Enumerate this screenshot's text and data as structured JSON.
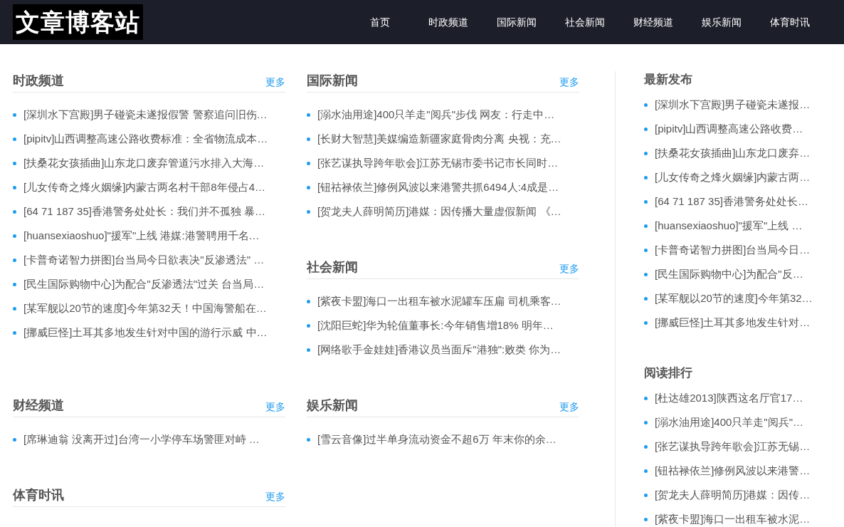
{
  "header": {
    "logo": "文章博客站",
    "nav": [
      "首页",
      "时政频道",
      "国际新闻",
      "社会新闻",
      "财经频道",
      "娱乐新闻",
      "体育时讯"
    ]
  },
  "main_rows": [
    {
      "columns": [
        [
          {
            "title": "时政频道",
            "more": "更多",
            "items": [
              "[深圳水下宫殿]男子碰瓷未遂报假警 警察追问旧伤…",
              "[pipitv]山西调整高速公路收费标准：全省物流成本…",
              "[扶桑花女孩插曲]山东龙口废弃管道污水排入大海…",
              "[儿女传奇之烽火姻缘]内蒙古两名村干部8年侵占4…",
              "[64 71 187 35]香港警务处处长：我们并不孤独 暴…",
              "[huansexiaoshuo]\"援军\"上线 港媒:港警聘用千名…",
              "[卡普奇诺智力拼图]台当局今日欲表决\"反渗透法\" …",
              "[民生国际购物中心]为配合\"反渗透法\"过关 台当局…",
              "[某军舰以20节的速度]今年第32天！中国海警船在…",
              "[挪威巨怪]土耳其多地发生针对中国的游行示威 中…"
            ]
          }
        ],
        [
          {
            "title": "国际新闻",
            "more": "更多",
            "items": [
              "[溺水油用途]400只羊走\"阅兵\"步伐 网友：行走中…",
              "[长财大智慧]美媒编造新疆家庭骨肉分离 央视：充…",
              "[张艺谋执导跨年歌会]江苏无锡市委书记市长同时…",
              "[钮祜禄依兰]修例风波以来港警共抓6494人:4成是…",
              "[贺龙夫人薛明简历]港媒：因传播大量虚假新闻 《…"
            ]
          },
          {
            "title": "社会新闻",
            "more": "更多",
            "items": [
              "[紫夜卡盟]海口一出租车被水泥罐车压扁 司机乘客…",
              "[沈阳巨蛇]华为轮值董事长:今年销售增18% 明年…",
              "[网络歌手金娃娃]香港议员当面斥\"港独\":败类 你为…"
            ]
          }
        ]
      ]
    },
    {
      "columns": [
        [
          {
            "title": "财经频道",
            "more": "更多",
            "items": [
              "[席琳迪翁 没离开过]台湾一小学停车场警匪对峙 …"
            ]
          }
        ],
        [
          {
            "title": "娱乐新闻",
            "more": "更多",
            "items": [
              "[雪云音像]过半单身流动资金不超6万 年末你的余…"
            ]
          }
        ]
      ]
    },
    {
      "columns": [
        [
          {
            "title": "体育时讯",
            "more": "更多"
          }
        ]
      ]
    }
  ],
  "sidebar": [
    {
      "title": "最新发布",
      "items": [
        "[深圳水下宫殿]男子碰瓷未遂报…",
        "[pipitv]山西调整高速公路收费…",
        "[扶桑花女孩插曲]山东龙口废弃…",
        "[儿女传奇之烽火姻缘]内蒙古两…",
        "[64 71 187 35]香港警务处处长…",
        "[huansexiaoshuo]\"援军\"上线 …",
        "[卡普奇诺智力拼图]台当局今日…",
        "[民生国际购物中心]为配合\"反…",
        "[某军舰以20节的速度]今年第32…",
        "[挪威巨怪]土耳其多地发生针对…"
      ]
    },
    {
      "title": "阅读排行",
      "items": [
        "[杜达雄2013]陕西这名厅官17…",
        "[溺水油用途]400只羊走\"阅兵\"…",
        "[张艺谋执导跨年歌会]江苏无锡…",
        "[钮祜禄依兰]修例风波以来港警…",
        "[贺龙夫人薛明简历]港媒：因传…",
        "[紫夜卡盟]海口一出租车被水泥…"
      ]
    }
  ]
}
